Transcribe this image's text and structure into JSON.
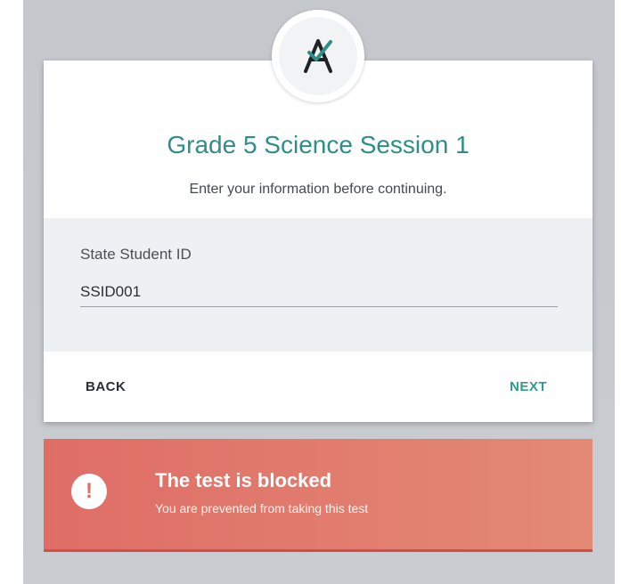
{
  "logo": {
    "letter": "A",
    "icon": "check-slash-logo-icon",
    "accent": "#2f8f86"
  },
  "header": {
    "title": "Grade 5 Science Session 1",
    "subtitle": "Enter your information before continuing."
  },
  "form": {
    "student_id_label": "State Student ID",
    "student_id_value": "SSID001"
  },
  "actions": {
    "back_label": "BACK",
    "next_label": "NEXT"
  },
  "alert": {
    "icon": "exclamation-icon",
    "title": "The test is blocked",
    "message": "You are prevented from taking this test",
    "color": "#df6d66"
  }
}
